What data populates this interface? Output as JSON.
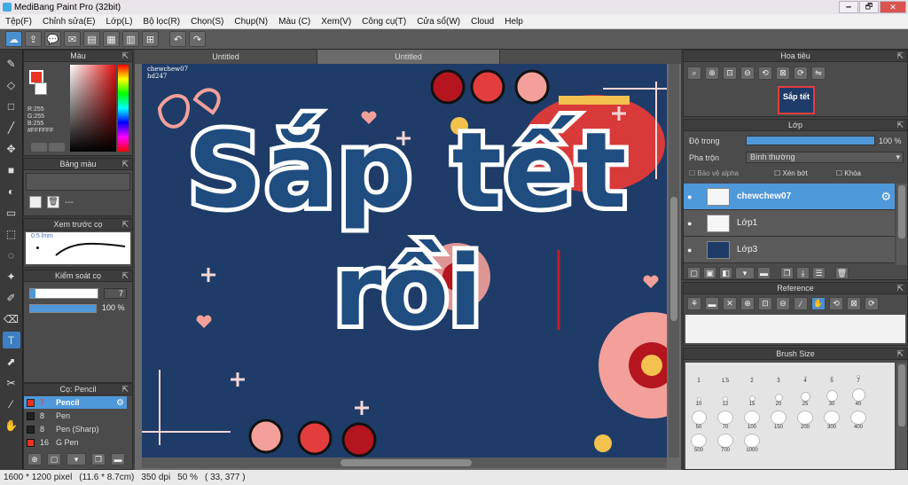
{
  "window": {
    "title": "MediBang Paint Pro (32bit)",
    "min": "🗕",
    "max": "🗗",
    "close": "✕"
  },
  "menu": [
    "Tệp(F)",
    "Chỉnh sửa(E)",
    "Lớp(L)",
    "Bộ lọc(R)",
    "Chọn(S)",
    "Chụp(N)",
    "Màu (C)",
    "Xem(V)",
    "Công cụ(T)",
    "Cửa sổ(W)",
    "Cloud",
    "Help"
  ],
  "tabs": [
    "Untitled",
    "Untitled"
  ],
  "canvas": {
    "corner_text_1": "chewchew07",
    "corner_text_2": "hd247",
    "title_line1": "Sắp tết",
    "title_line2": "rồi"
  },
  "color_panel": {
    "title": "Màu",
    "r": "R:255",
    "g": "G:255",
    "b": "B:255",
    "hex": "#FFFFFF",
    "fg": "#ea3323",
    "bg": "#ffffff"
  },
  "palette_panel": {
    "title": "Bảng màu",
    "dash": "---"
  },
  "preview_panel": {
    "title": "Xem trước cọ",
    "size": "0.5 lmm"
  },
  "brush_control": {
    "title": "Kiểm soát cọ",
    "size_value": "7",
    "opacity_value": "100 %"
  },
  "brush_list": {
    "title": "Cọ: Pencil",
    "items": [
      {
        "size": "7",
        "name": "Pencil",
        "color": "#ea3323"
      },
      {
        "size": "8",
        "name": "Pen",
        "color": "#222222"
      },
      {
        "size": "8",
        "name": "Pen (Sharp)",
        "color": "#222222"
      },
      {
        "size": "16",
        "name": "G Pen",
        "color": "#ea3323"
      }
    ]
  },
  "navigator": {
    "title": "Hoa tiêu"
  },
  "layer_panel": {
    "title": "Lớp",
    "opacity_label": "Độ trong",
    "opacity_value": "100 %",
    "blend_label": "Pha trộn",
    "blend_value": "Bình thường",
    "protect_alpha": "Bảo vệ alpha",
    "clipping": "Xén bớt",
    "lock": "Khóa",
    "layers": [
      {
        "name": "chewchew07",
        "selected": true
      },
      {
        "name": "Lớp1",
        "selected": false
      },
      {
        "name": "Lớp3",
        "selected": false
      }
    ]
  },
  "reference": {
    "title": "Reference"
  },
  "brush_size": {
    "title": "Brush Size",
    "sizes": [
      "1",
      "1.5",
      "2",
      "3",
      "4",
      "5",
      "7",
      "10",
      "12",
      "15",
      "20",
      "25",
      "30",
      "40",
      "50",
      "70",
      "100",
      "150",
      "200",
      "300",
      "400",
      "500",
      "700",
      "1000"
    ]
  },
  "status": {
    "pixels": "1600 * 1200 pixel",
    "cm": "(11.6 * 8.7cm)",
    "dpi": "350 dpi",
    "zoom": "50 %",
    "coords": "( 33, 377 )"
  },
  "colors": {
    "accent": "#4f98d9",
    "canvas_bg": "#1f3c68",
    "flower_pink": "#f3a09a",
    "flower_red": "#b4151e",
    "gold": "#f2c14e"
  }
}
